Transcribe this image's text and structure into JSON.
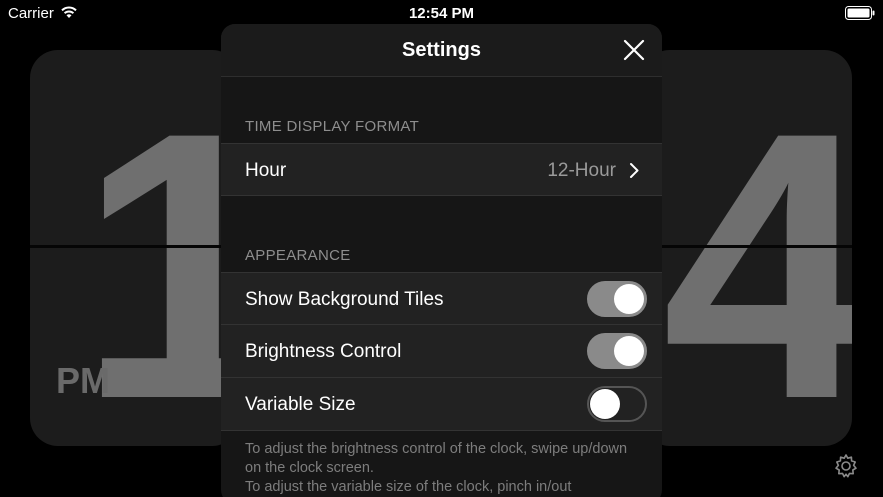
{
  "status_bar": {
    "carrier": "Carrier",
    "time": "12:54 PM"
  },
  "clock": {
    "hour_digit": "1",
    "minute_digit": "4",
    "ampm": "PM"
  },
  "settings": {
    "title": "Settings",
    "time_section_label": "TIME DISPLAY FORMAT",
    "hour_row": {
      "label": "Hour",
      "value": "12-Hour"
    },
    "appearance_section_label": "APPEARANCE",
    "toggles": [
      {
        "label": "Show Background Tiles",
        "on": true
      },
      {
        "label": "Brightness Control",
        "on": true
      },
      {
        "label": "Variable Size",
        "on": false
      }
    ],
    "footnote_line1": "To adjust the brightness control of the clock, swipe up/down on the clock screen.",
    "footnote_line2": "To adjust the variable size of the clock, pinch in/out"
  },
  "colors": {
    "toggle_on": "#8a8a8a",
    "background": "#000000",
    "digit": "#6f6f6f"
  }
}
